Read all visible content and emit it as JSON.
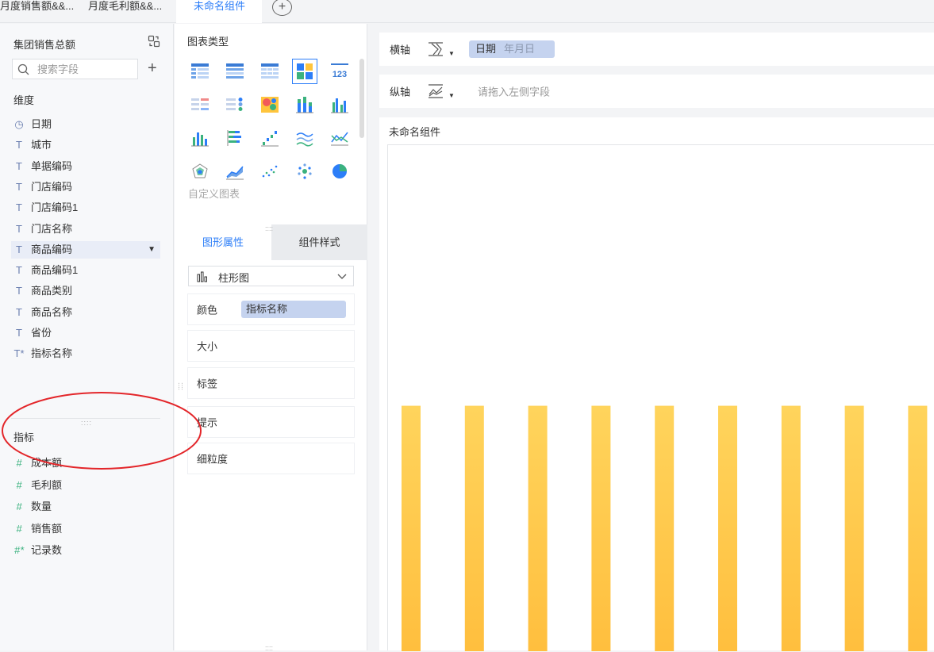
{
  "top_tabs": [
    {
      "label": "月度销售额&&..."
    },
    {
      "label": "月度毛利额&&..."
    },
    {
      "label": "未命名组件",
      "active": true
    }
  ],
  "left_panel": {
    "dataset_title": "集团销售总额",
    "search_placeholder": "搜索字段",
    "dimension_title": "维度",
    "dimensions": [
      {
        "label": "日期",
        "icon": "clock-icon",
        "glyph": "◷"
      },
      {
        "label": "城市",
        "icon": "text-field-icon",
        "glyph": "T"
      },
      {
        "label": "单据编码",
        "icon": "text-field-icon",
        "glyph": "T"
      },
      {
        "label": "门店编码",
        "icon": "text-field-icon",
        "glyph": "T"
      },
      {
        "label": "门店编码1",
        "icon": "text-field-icon",
        "glyph": "T"
      },
      {
        "label": "门店名称",
        "icon": "text-field-icon",
        "glyph": "T"
      },
      {
        "label": "商品编码",
        "icon": "text-field-icon",
        "glyph": "T",
        "highlighted": true
      },
      {
        "label": "商品编码1",
        "icon": "text-field-icon",
        "glyph": "T"
      },
      {
        "label": "商品类别",
        "icon": "text-field-icon",
        "glyph": "T"
      },
      {
        "label": "商品名称",
        "icon": "text-field-icon",
        "glyph": "T"
      },
      {
        "label": "省份",
        "icon": "text-field-icon",
        "glyph": "T"
      },
      {
        "label": "指标名称",
        "icon": "text-field-calc-icon",
        "glyph": "T*"
      }
    ],
    "measure_title": "指标",
    "measures": [
      {
        "label": "成本额",
        "icon": "number-field-icon",
        "glyph": "#"
      },
      {
        "label": "毛利额",
        "icon": "number-field-icon",
        "glyph": "#"
      },
      {
        "label": "数量",
        "icon": "number-field-icon",
        "glyph": "#"
      },
      {
        "label": "销售额",
        "icon": "number-field-icon",
        "glyph": "#"
      },
      {
        "label": "记录数",
        "icon": "number-field-calc-icon",
        "glyph": "#*"
      }
    ]
  },
  "middle_panel": {
    "chart_type_title": "图表类型",
    "custom_chart_label": "自定义图表",
    "tabs": {
      "graph_attr": "图形属性",
      "component_style": "组件样式"
    },
    "chart_select": "柱形图",
    "props": {
      "color_label": "颜色",
      "color_value": "指标名称",
      "size_label": "大小",
      "label_label": "标签",
      "tooltip_label": "提示",
      "granularity_label": "细粒度"
    }
  },
  "right_panel": {
    "x_axis_label": "横轴",
    "x_field": "日期",
    "x_field_sub": "年月日",
    "y_axis_label": "纵轴",
    "y_placeholder": "请拖入左侧字段",
    "canvas_title": "未命名组件"
  },
  "colors": {
    "accent": "#2c7ef8",
    "bar_top": "#ffd45c",
    "bar_bottom": "#ffbe3d",
    "annotation": "#e3262a"
  },
  "chart_data": {
    "type": "bar",
    "categories": [
      "",
      "",
      "",
      "",
      "",
      "",
      "",
      "",
      ""
    ],
    "values": [
      1,
      1,
      1,
      1,
      1,
      1,
      1,
      1,
      1
    ],
    "title": "",
    "xlabel": "",
    "ylabel": "",
    "ylim": [
      0,
      1.0
    ]
  }
}
